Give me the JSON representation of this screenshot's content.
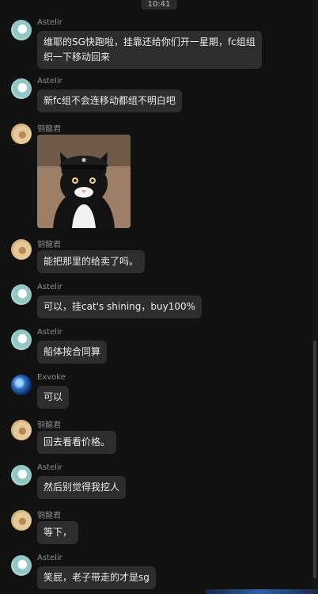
{
  "header": {
    "time": "10:41"
  },
  "messages": [
    {
      "sender": "Astelir",
      "text": "维耶的SG快跑啦，挂靠还给你们开一星期，fc组组织一下移动回来"
    },
    {
      "sender": "Astelir",
      "text": "新fc组不会连移动都组不明白吧"
    },
    {
      "sender": "铜龍君",
      "image": "cat-in-officer-cap-photo"
    },
    {
      "sender": "铜龍君",
      "text": "能把那里的给卖了吗。"
    },
    {
      "sender": "Astelir",
      "text": "可以，挂cat's shining，buy100%"
    },
    {
      "sender": "Astelir",
      "text": "船体按合同算"
    },
    {
      "sender": "Exvoke",
      "text": "可以"
    },
    {
      "sender": "铜龍君",
      "text": "回去看看价格。"
    },
    {
      "sender": "Astelir",
      "text": "然后别觉得我挖人"
    },
    {
      "sender": "铜龍君",
      "text": "等下，"
    },
    {
      "sender": "Astelir",
      "text": "笑屁，老子带走的才是sg"
    }
  ],
  "colors": {
    "background": "#111111",
    "bubble": "#2d2d2d",
    "bubble_text": "#ececec",
    "sender_text": "#8e8e8e"
  }
}
